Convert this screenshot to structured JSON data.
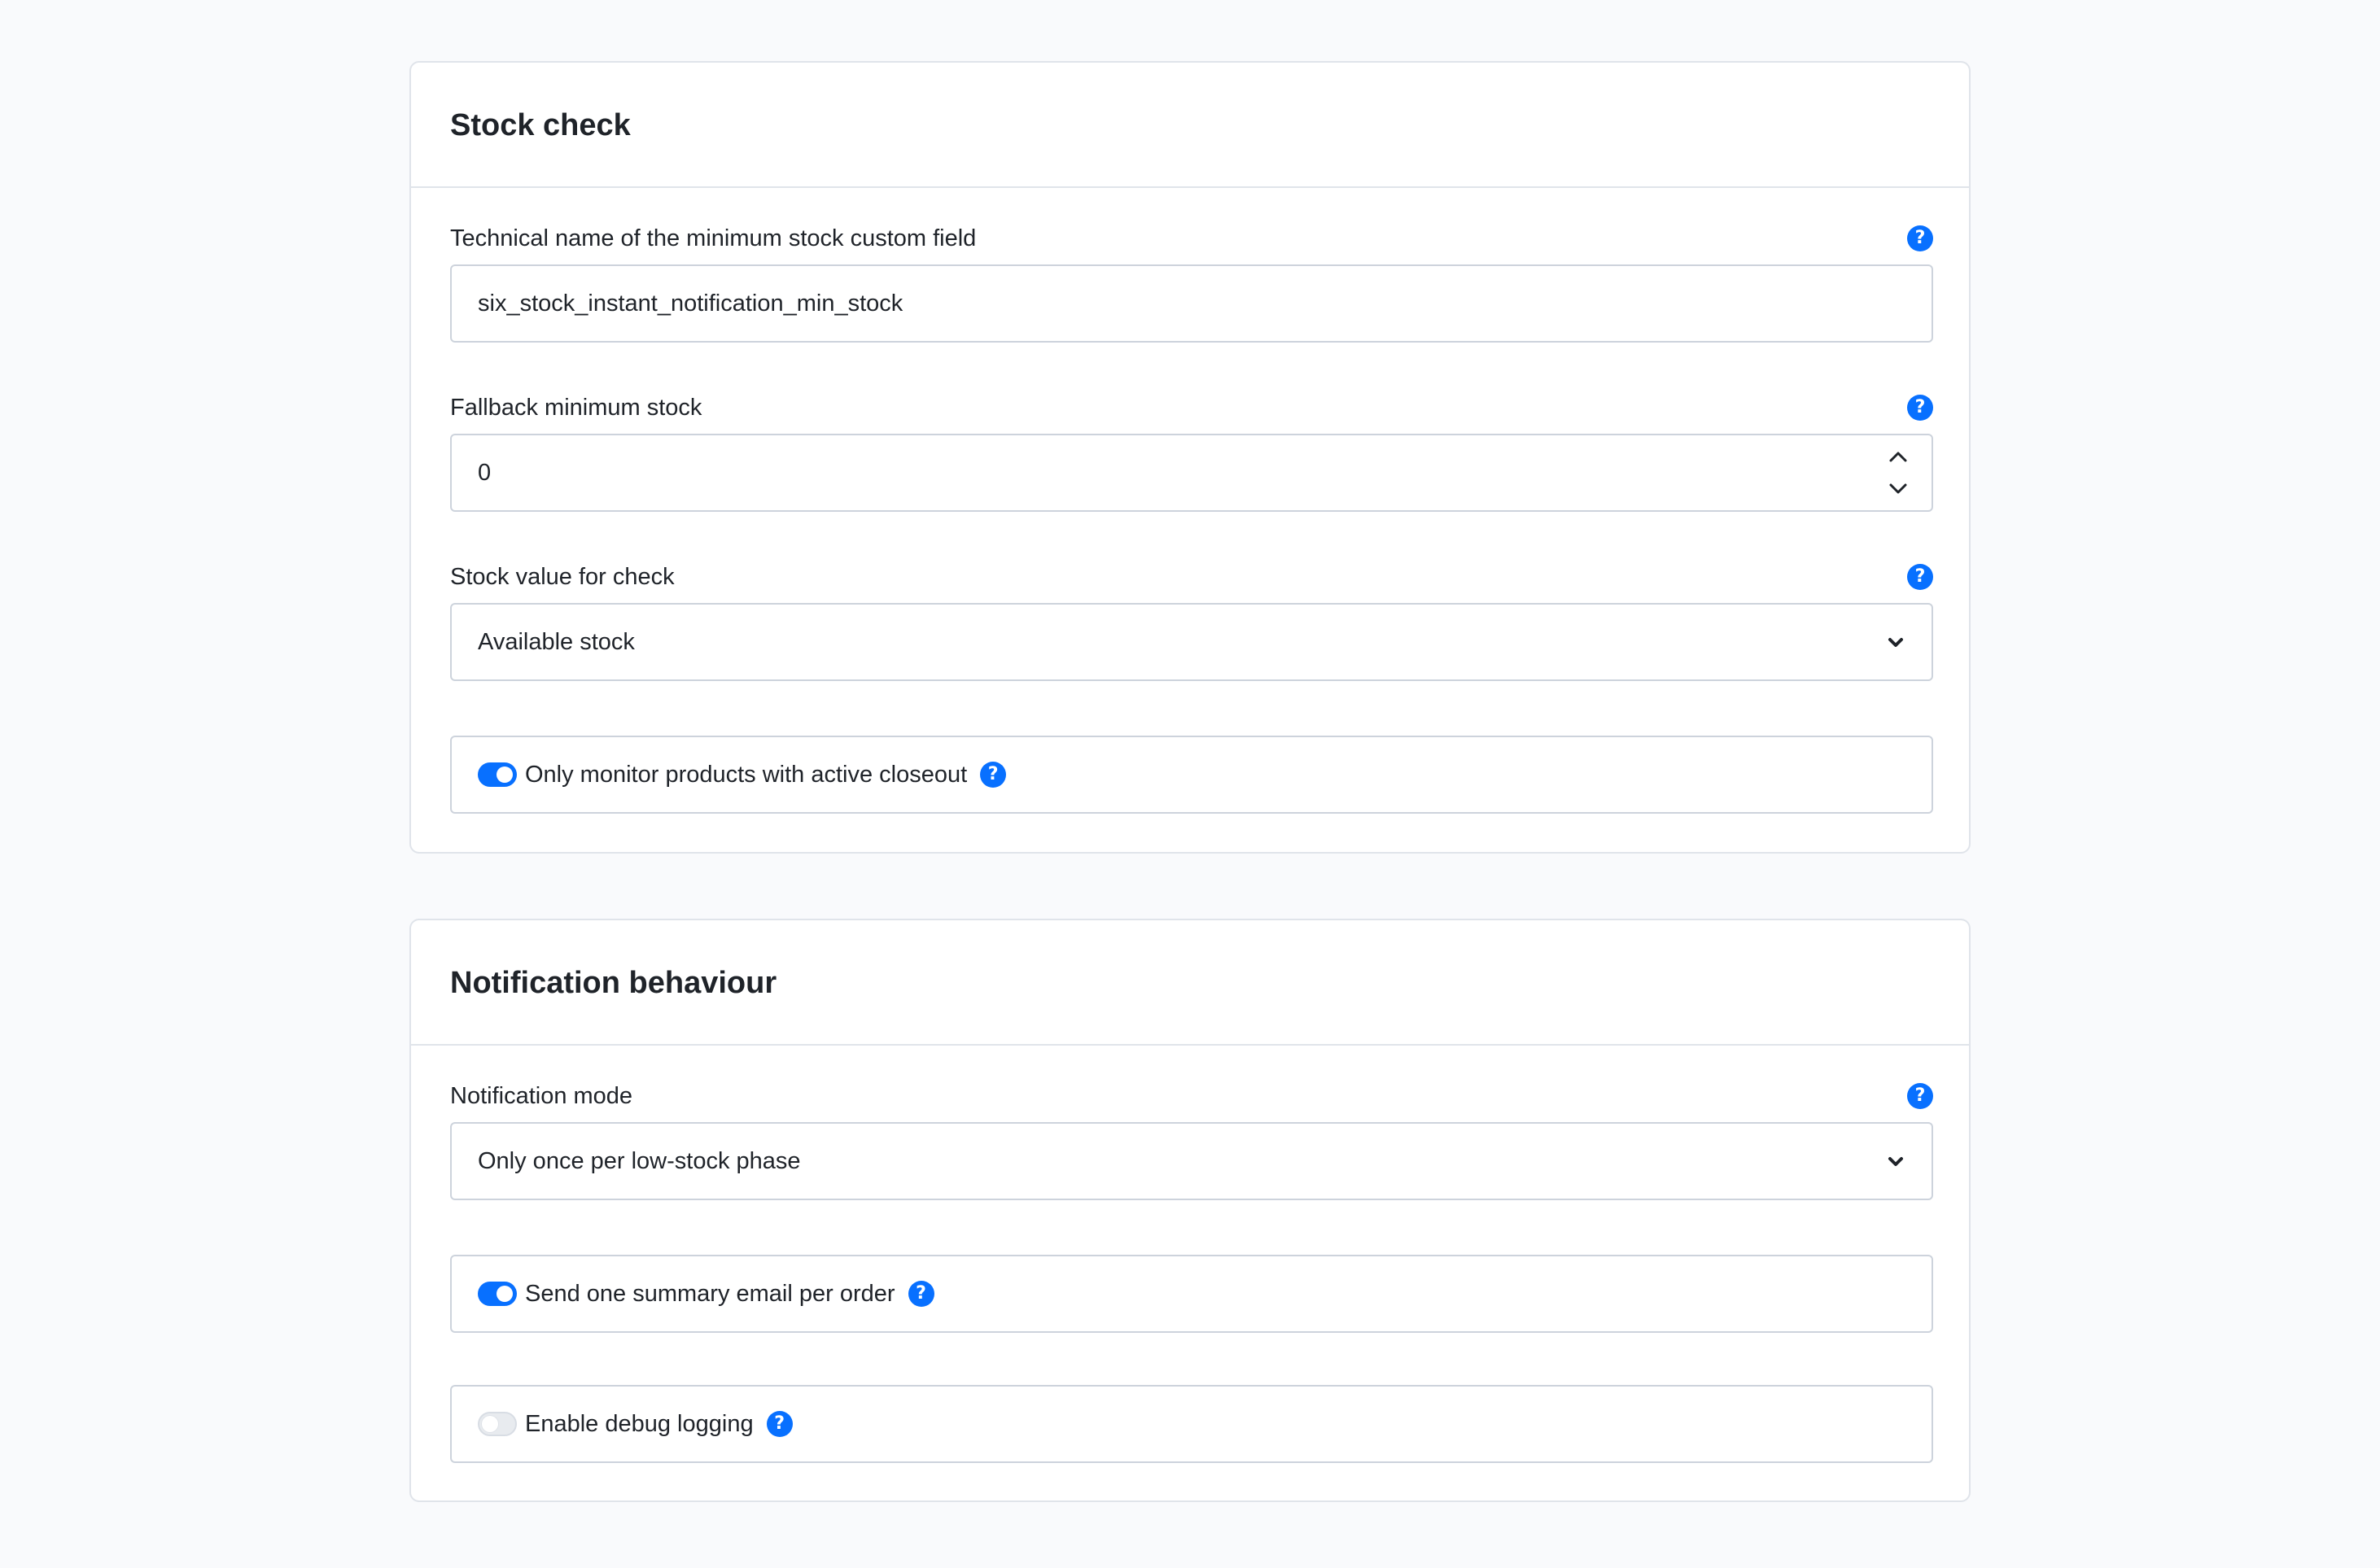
{
  "stock_check": {
    "title": "Stock check",
    "min_stock_field": {
      "label": "Technical name of the minimum stock custom field",
      "value": "six_stock_instant_notification_min_stock"
    },
    "fallback_min_stock": {
      "label": "Fallback minimum stock",
      "value": "0"
    },
    "stock_value": {
      "label": "Stock value for check",
      "selected": "Available stock"
    },
    "closeout_toggle": {
      "label": "Only monitor products with active closeout",
      "enabled": true
    }
  },
  "notification_behaviour": {
    "title": "Notification behaviour",
    "notification_mode": {
      "label": "Notification mode",
      "selected": "Only once per low-stock phase"
    },
    "summary_email_toggle": {
      "label": "Send one summary email per order",
      "enabled": true
    },
    "debug_logging_toggle": {
      "label": "Enable debug logging",
      "enabled": false
    }
  },
  "help_glyph": "?",
  "colors": {
    "accent": "#0870ff",
    "border": "#cdd3dc",
    "background": "#f9fafc"
  },
  "icons": {
    "help": "question-circle-icon",
    "select": "chevron-down-icon",
    "stepper_up": "chevron-up-icon",
    "stepper_down": "chevron-down-icon"
  }
}
